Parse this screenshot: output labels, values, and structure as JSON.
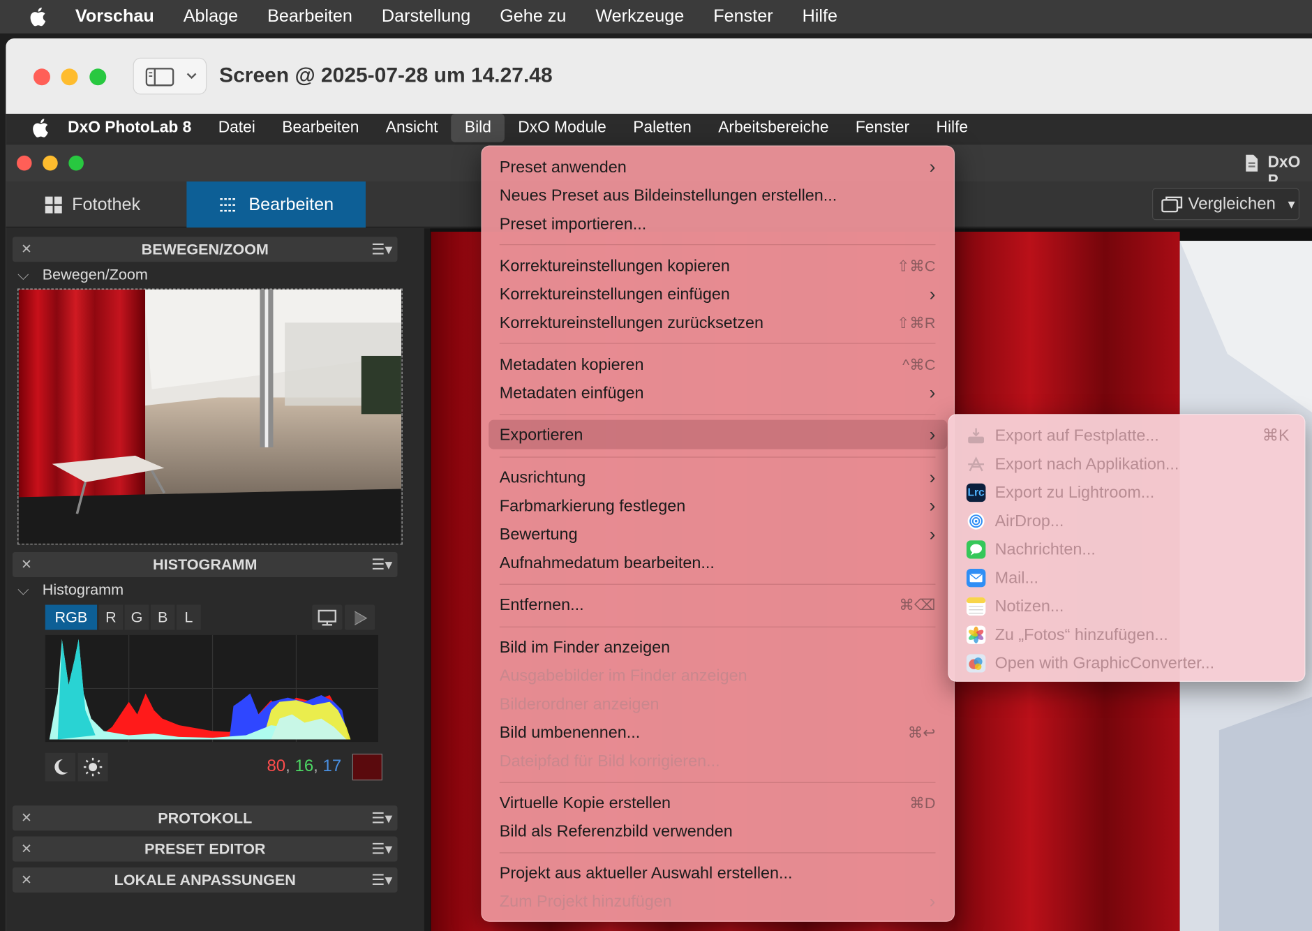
{
  "system_menubar": {
    "app": "Vorschau",
    "items": [
      "Ablage",
      "Bearbeiten",
      "Darstellung",
      "Gehe zu",
      "Werkzeuge",
      "Fenster",
      "Hilfe"
    ]
  },
  "preview_window": {
    "title": "Screen @ 2025-07-28 um 14.27.48"
  },
  "dxo_menubar": {
    "app": "DxO PhotoLab 8",
    "items": [
      "Datei",
      "Bearbeiten",
      "Ansicht",
      "Bild",
      "DxO Module",
      "Paletten",
      "Arbeitsbereiche",
      "Fenster",
      "Hilfe"
    ]
  },
  "dxo_window": {
    "title_fragment": "DxO P",
    "tabs": [
      "Fotothek",
      "Bearbeiten"
    ],
    "compare_label": "Vergleichen"
  },
  "left_panel": {
    "move_zoom": {
      "header": "BEWEGEN/ZOOM",
      "sub": "Bewegen/Zoom"
    },
    "histogram": {
      "header": "HISTOGRAMM",
      "sub": "Histogramm",
      "channels": [
        "RGB",
        "R",
        "G",
        "B",
        "L"
      ],
      "rgb_values": {
        "r": "80",
        "g": "16",
        "b": "17"
      },
      "swatch": "#5a0a0d"
    },
    "collapsed_panels": [
      "PROTOKOLL",
      "PRESET EDITOR",
      "LOKALE ANPASSUNGEN"
    ]
  },
  "bild_menu": {
    "items": [
      {
        "label": "Preset anwenden",
        "arrow": true
      },
      {
        "label": "Neues Preset aus Bildeinstellungen erstellen..."
      },
      {
        "label": "Preset importieren..."
      },
      {
        "label": "Korrektureinstellungen kopieren",
        "shortcut": "⇧⌘C"
      },
      {
        "label": "Korrektureinstellungen einfügen",
        "arrow": true
      },
      {
        "label": "Korrektureinstellungen zurücksetzen",
        "shortcut": "⇧⌘R"
      },
      {
        "label": "Metadaten kopieren",
        "shortcut": "^⌘C"
      },
      {
        "label": "Metadaten einfügen",
        "arrow": true
      },
      {
        "label": "Exportieren",
        "arrow": true,
        "highlighted": true
      },
      {
        "label": "Ausrichtung",
        "arrow": true
      },
      {
        "label": "Farbmarkierung festlegen",
        "arrow": true
      },
      {
        "label": "Bewertung",
        "arrow": true
      },
      {
        "label": "Aufnahmedatum bearbeiten..."
      },
      {
        "label": "Entfernen...",
        "shortcut": "⌘⌫"
      },
      {
        "label": "Bild im Finder anzeigen"
      },
      {
        "label": "Ausgabebilder im Finder anzeigen",
        "disabled": true
      },
      {
        "label": "Bilderordner anzeigen",
        "disabled": true
      },
      {
        "label": "Bild umbenennen...",
        "shortcut": "⌘↩"
      },
      {
        "label": "Dateipfad für Bild korrigieren...",
        "disabled": true
      },
      {
        "label": "Virtuelle Kopie erstellen",
        "shortcut": "⌘D"
      },
      {
        "label": "Bild als Referenzbild verwenden"
      },
      {
        "label": "Projekt aus aktueller Auswahl erstellen..."
      },
      {
        "label": "Zum Projekt hinzufügen",
        "arrow": true,
        "disabled": true
      }
    ]
  },
  "export_submenu": {
    "items": [
      {
        "label": "Export auf Festplatte...",
        "shortcut": "⌘K",
        "icon": "disk-export-icon"
      },
      {
        "label": "Export nach Applikation...",
        "icon": "app-export-icon"
      },
      {
        "label": "Export zu Lightroom...",
        "icon": "lightroom-icon",
        "icon_text": "Lrc"
      },
      {
        "label": "AirDrop...",
        "icon": "airdrop-icon"
      },
      {
        "label": "Nachrichten...",
        "icon": "messages-icon"
      },
      {
        "label": "Mail...",
        "icon": "mail-icon"
      },
      {
        "label": "Notizen...",
        "icon": "notes-icon"
      },
      {
        "label": "Zu „Fotos“ hinzufügen...",
        "icon": "photos-icon"
      },
      {
        "label": "Open with GraphicConverter...",
        "icon": "graphicconverter-icon"
      }
    ]
  },
  "colors": {
    "accent_tab": "#0d5f96",
    "menu_tint": "#e88f96",
    "rgb_r": "#ff4d4d",
    "rgb_g": "#4cd964",
    "rgb_b": "#4a90e2"
  }
}
